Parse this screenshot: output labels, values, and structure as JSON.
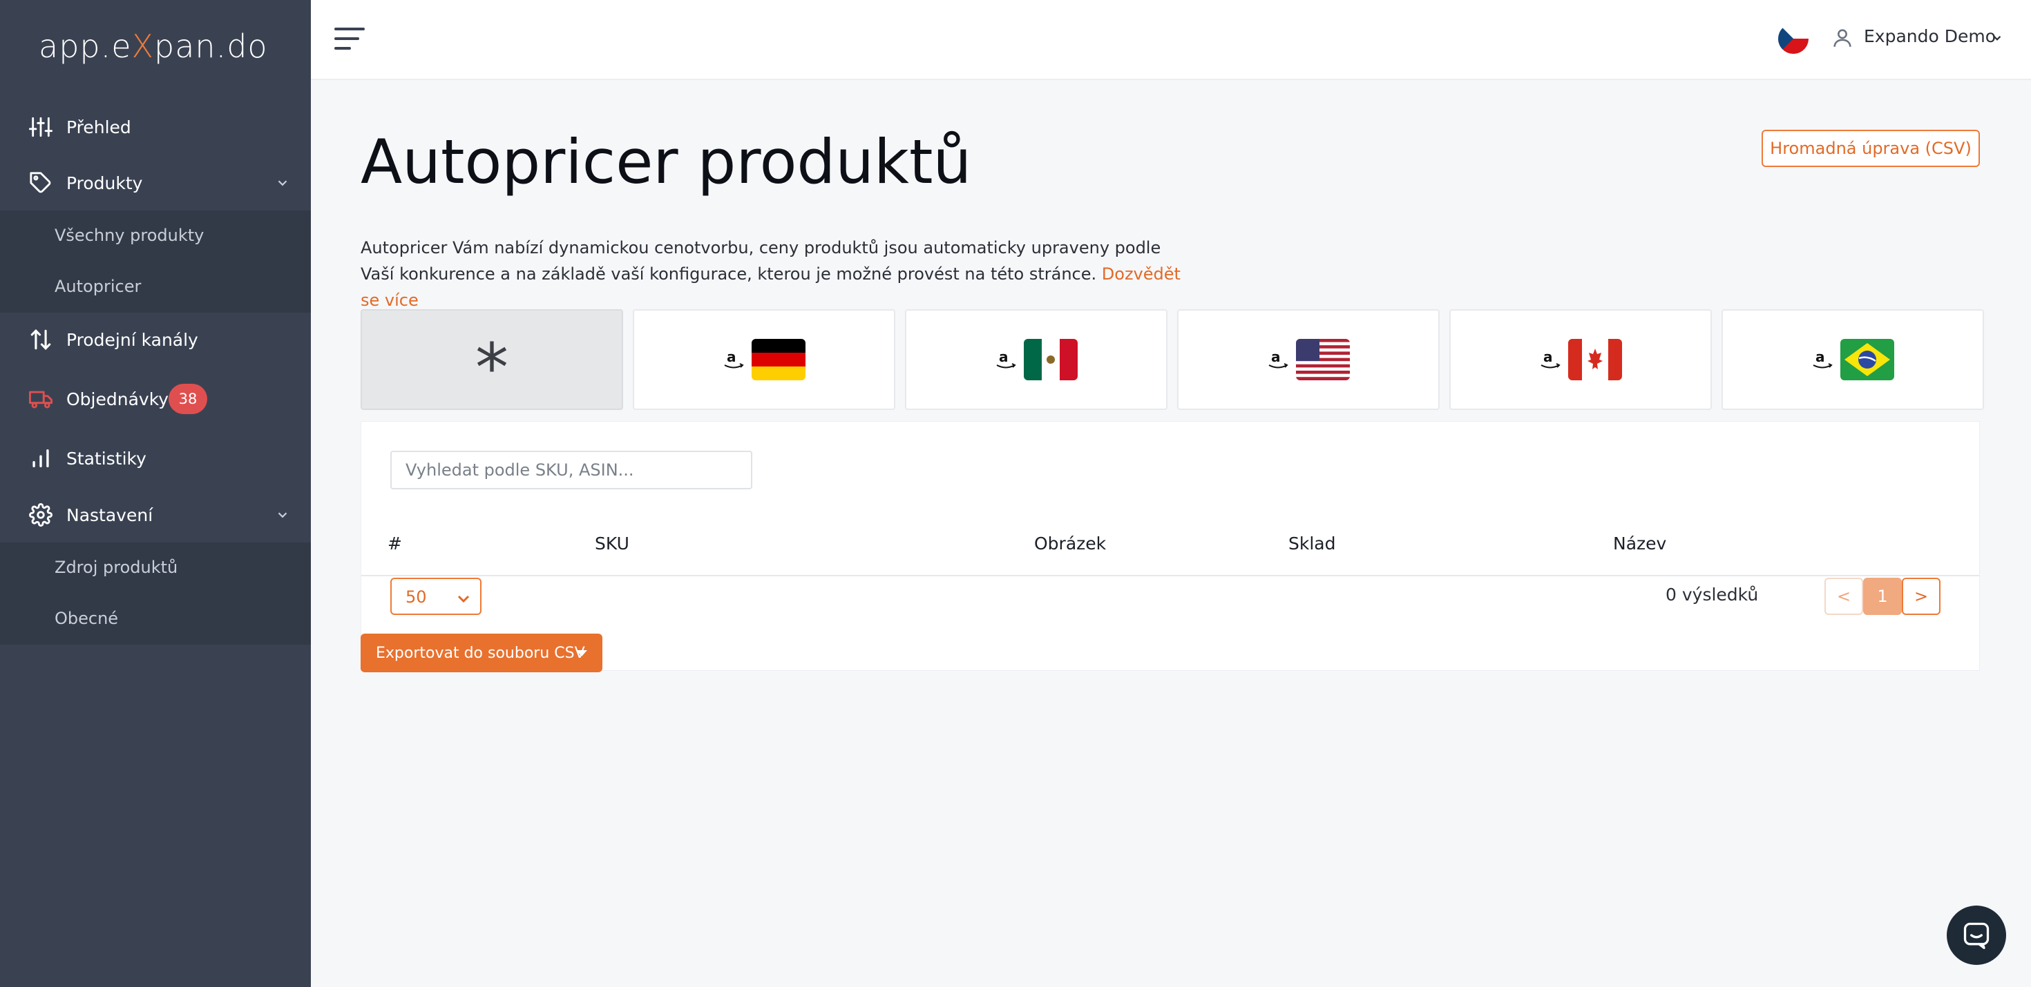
{
  "sidebar": {
    "logo": {
      "part1": "app.e",
      "x": "X",
      "part2": "pan.do"
    },
    "items": [
      {
        "label": "Přehled",
        "icon": "sliders-icon"
      },
      {
        "label": "Produkty",
        "icon": "tag-icon"
      },
      {
        "label": "Prodejní kanály",
        "icon": "arrows-updown-icon"
      },
      {
        "label": "Objednávky",
        "icon": "truck-icon",
        "badge": "38"
      },
      {
        "label": "Statistiky",
        "icon": "bar-chart-icon"
      },
      {
        "label": "Nastavení",
        "icon": "gear-icon"
      }
    ],
    "produkty_sub": [
      "Všechny produkty",
      "Autopricer"
    ],
    "nastaveni_sub": [
      "Zdroj produktů",
      "Obecné"
    ]
  },
  "topbar": {
    "language_flag": "cz-flag-icon",
    "user_name": "Expando Demo"
  },
  "main": {
    "title": "Autopricer produktů",
    "bulk_button": "Hromadná úprava (CSV)",
    "description": "Autopricer Vám nabízí dynamickou cenotvorbu, ceny produktů jsou automaticky upraveny podle Vaší konkurence a na základě vaší konfigurace, kterou je možné provést na této stránce.",
    "learn_more": "Dozvědět se více",
    "marketplace_tiles": [
      {
        "label": "*",
        "active": true
      },
      {
        "icon": "amazon-de-flag",
        "active": false
      },
      {
        "icon": "amazon-mx-flag",
        "active": false
      },
      {
        "icon": "amazon-us-flag",
        "active": false
      },
      {
        "icon": "amazon-ca-flag",
        "active": false
      },
      {
        "icon": "amazon-br-flag",
        "active": false
      }
    ],
    "search_placeholder": "Vyhledat podle SKU, ASIN...",
    "columns": [
      "#",
      "SKU",
      "Obrázek",
      "Sklad",
      "Název"
    ],
    "per_page": "50",
    "results": "0 výsledků",
    "pagination": {
      "prev": "<",
      "current": "1",
      "next": ">"
    },
    "export_button": "Exportovat do souboru CSV"
  },
  "colors": {
    "accent": "#e8712e",
    "sidebar": "#3a4252",
    "badge": "#e04f4f"
  }
}
